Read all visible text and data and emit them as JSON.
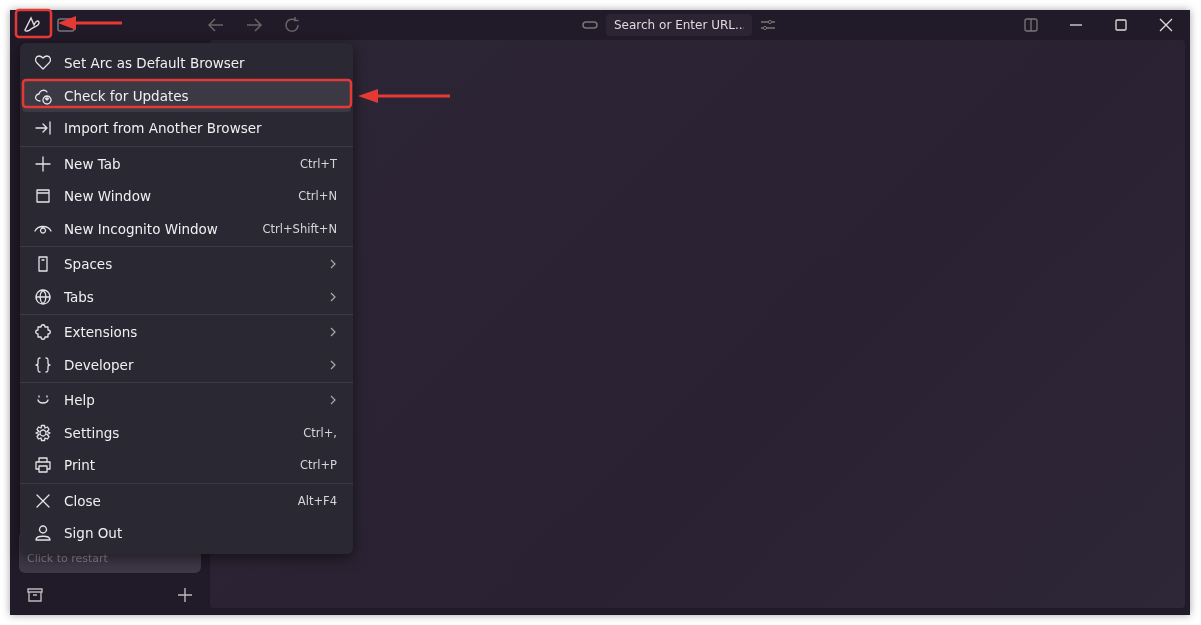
{
  "toolbar": {
    "address_placeholder": "Search or Enter URL..."
  },
  "sidebar": {
    "notice": "Click to restart"
  },
  "menu": {
    "sections": [
      [
        {
          "label": "Set Arc as Default Browser",
          "highlighted": false,
          "submenu": false
        },
        {
          "label": "Check for Updates",
          "highlighted": true,
          "submenu": false
        },
        {
          "label": "Import from Another Browser",
          "highlighted": false,
          "submenu": false
        }
      ],
      [
        {
          "label": "New Tab",
          "shortcut": "Ctrl+T",
          "highlighted": false,
          "submenu": false
        },
        {
          "label": "New Window",
          "shortcut": "Ctrl+N",
          "highlighted": false,
          "submenu": false
        },
        {
          "label": "New Incognito Window",
          "shortcut": "Ctrl+Shift+N",
          "highlighted": false,
          "submenu": false
        }
      ],
      [
        {
          "label": "Spaces",
          "highlighted": false,
          "submenu": true
        },
        {
          "label": "Tabs",
          "highlighted": false,
          "submenu": true
        }
      ],
      [
        {
          "label": "Extensions",
          "highlighted": false,
          "submenu": true
        },
        {
          "label": "Developer",
          "highlighted": false,
          "submenu": true
        }
      ],
      [
        {
          "label": "Help",
          "highlighted": false,
          "submenu": true
        },
        {
          "label": "Settings",
          "shortcut": "Ctrl+,",
          "highlighted": false,
          "submenu": false
        },
        {
          "label": "Print",
          "shortcut": "Ctrl+P",
          "highlighted": false,
          "submenu": false
        }
      ],
      [
        {
          "label": "Close",
          "shortcut": "Alt+F4",
          "highlighted": false,
          "submenu": false
        },
        {
          "label": "Sign Out",
          "highlighted": false,
          "submenu": false
        }
      ]
    ]
  }
}
